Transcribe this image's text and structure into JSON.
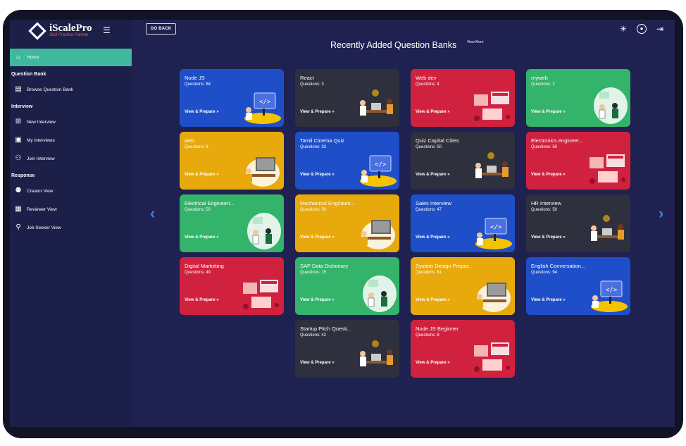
{
  "app": {
    "brand": "iScalePro",
    "tagline": "Skill Practice Partner"
  },
  "topbar": {
    "go_back": "GO BACK"
  },
  "nav": {
    "home": "Home",
    "sections": [
      {
        "title": "Question Bank",
        "items": [
          {
            "label": "Browse Question Bank",
            "icon": "book-icon"
          }
        ]
      },
      {
        "title": "Interview",
        "items": [
          {
            "label": "New Interview",
            "icon": "plus-box-icon"
          },
          {
            "label": "My Interviews",
            "icon": "person-box-icon"
          },
          {
            "label": "Join Interview",
            "icon": "group-icon"
          }
        ]
      },
      {
        "title": "Response",
        "items": [
          {
            "label": "Creator View",
            "icon": "creator-icon"
          },
          {
            "label": "Reviewer View",
            "icon": "reviewer-icon"
          },
          {
            "label": "Job Seeker View",
            "icon": "user-icon"
          }
        ]
      }
    ]
  },
  "main": {
    "title": "Recently Added Question Banks",
    "view_more": "View More",
    "cta": "View & Prepare",
    "cards": [
      {
        "title": "Node JS",
        "questions": "Questions: 64",
        "color": "blue",
        "illustration": "coder-icon"
      },
      {
        "title": "React",
        "questions": "Questions: 3",
        "color": "dark",
        "illustration": "meeting-icon"
      },
      {
        "title": "Web dev",
        "questions": "Questions: 4",
        "color": "red",
        "illustration": "web-icon"
      },
      {
        "title": "myweb",
        "questions": "Questions: 2",
        "color": "green",
        "illustration": "people-icon"
      },
      {
        "title": "web",
        "questions": "Questions: 6",
        "color": "yellow",
        "illustration": "desk-icon"
      },
      {
        "title": "Tamil Cinema Quiz",
        "questions": "Questions: 33",
        "color": "blue",
        "illustration": "coder-icon"
      },
      {
        "title": "Quiz Capital Cities",
        "questions": "Questions: 50",
        "color": "dark",
        "illustration": "meeting-icon"
      },
      {
        "title": "Electronics engineer...",
        "questions": "Questions: 50",
        "color": "red",
        "illustration": "web-icon"
      },
      {
        "title": "Electrical Engineeri...",
        "questions": "Questions: 50",
        "color": "green",
        "illustration": "people-icon"
      },
      {
        "title": "Mechanical Engineeri...",
        "questions": "Questions: 50",
        "color": "yellow",
        "illustration": "desk-icon"
      },
      {
        "title": "Sales Interview",
        "questions": "Questions: 47",
        "color": "blue",
        "illustration": "coder-icon"
      },
      {
        "title": "HR Interview",
        "questions": "Questions: 50",
        "color": "dark",
        "illustration": "meeting-icon"
      },
      {
        "title": "Digital Marketing",
        "questions": "Questions: 49",
        "color": "red",
        "illustration": "web-icon"
      },
      {
        "title": "SAP Data Dictionary",
        "questions": "Questions: 15",
        "color": "green",
        "illustration": "people-icon"
      },
      {
        "title": "System Design Prepar...",
        "questions": "Questions: 81",
        "color": "yellow",
        "illustration": "desk-icon"
      },
      {
        "title": "English Conversation...",
        "questions": "Questions: 94",
        "color": "blue",
        "illustration": "coder-icon"
      },
      {
        "title": "Startup Pitch Questi...",
        "questions": "Questions: 42",
        "color": "dark",
        "illustration": "meeting-icon"
      },
      {
        "title": "Node JS Beginner",
        "questions": "Questions: 8",
        "color": "red",
        "illustration": "web-icon"
      }
    ]
  }
}
